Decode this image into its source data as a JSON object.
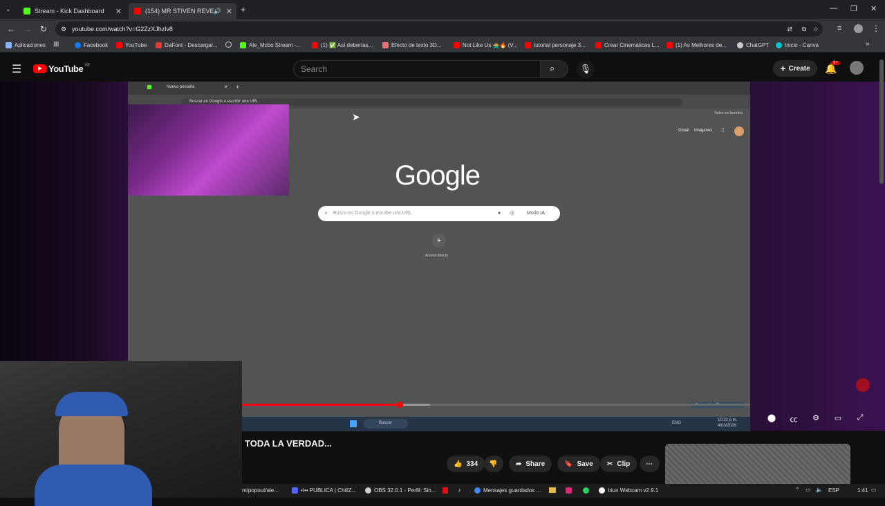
{
  "browser": {
    "tabs": [
      {
        "title": "Stream - Kick Dashboard",
        "color": "#53fc18"
      },
      {
        "title": "(154) MR STIVEN REVELA",
        "color": "#ff0000"
      }
    ],
    "url": "youtube.com/watch?v=G2ZzXJhzlv8",
    "bookmarks": [
      {
        "label": "Aplicaciones",
        "color": "#8ab4f8"
      },
      {
        "label": "Facebook",
        "color": "#1877f2"
      },
      {
        "label": "YouTube",
        "color": "#ff0000"
      },
      {
        "label": "DaFont - Descargar...",
        "color": "#e53935"
      },
      {
        "label": "Ale_Mcbo Stream -...",
        "color": "#53fc18"
      },
      {
        "label": "(1) ✅ Así deberías...",
        "color": "#ff0000"
      },
      {
        "label": "Efecto de texto 3D...",
        "color": "#e57373"
      },
      {
        "label": "Not Like Us 🙅‍♂️🔥 (V...",
        "color": "#ff0000"
      },
      {
        "label": "tutorial personaje 3...",
        "color": "#ff0000"
      },
      {
        "label": "Crear Cinemáticas L...",
        "color": "#ff0000"
      },
      {
        "label": "(1) As Melhores de...",
        "color": "#ff0000"
      },
      {
        "label": "ChatGPT",
        "color": "#cccccc"
      },
      {
        "label": "Inicio - Canva",
        "color": "#00c4cc"
      }
    ]
  },
  "youtube": {
    "logo_text": "YouTube",
    "logo_country": "VE",
    "search_placeholder": "Search",
    "create_label": "Create",
    "notif_badge": "9+",
    "video_title": "TODA LA VERDAD...",
    "likes": "334",
    "share_label": "Share",
    "save_label": "Save",
    "clip_label": "Clip",
    "progress_fraction": 0.31,
    "buffered_fraction": 0.37
  },
  "inner_screen": {
    "tab_title": "Nueva pestaña",
    "omnibox": "Buscar en Google o escribir una URL",
    "favorites": "Todos los favoritos",
    "gmail": "Gmail",
    "images": "Imágenes",
    "google_logo": "Google",
    "search_placeholder": "Busca en Google o escribe una URL",
    "ai_mode": "Modo IA",
    "shortcut_label": "Acceso directo",
    "customize": "Personalizar Chrome",
    "taskbar_search": "Buscar",
    "lang": "ENG",
    "time": "10:22 p.m.",
    "date": "4/03/2026"
  },
  "windows_taskbar": {
    "items": [
      {
        "label": "m/popout/ale...",
        "color": "#4285f4"
      },
      {
        "label": "•I•• PUBLICA | ChillZ...",
        "color": "#5865f2"
      },
      {
        "label": "OBS 32.0.1 - Perfil: Sin...",
        "color": "#cccccc"
      },
      {
        "label": "Mensajes guardados ...",
        "color": "#4285f4"
      },
      {
        "label": "Iriun Webcam v2.9.1",
        "color": "#ffffff"
      }
    ],
    "lang": "ESP",
    "time": "1:41"
  }
}
